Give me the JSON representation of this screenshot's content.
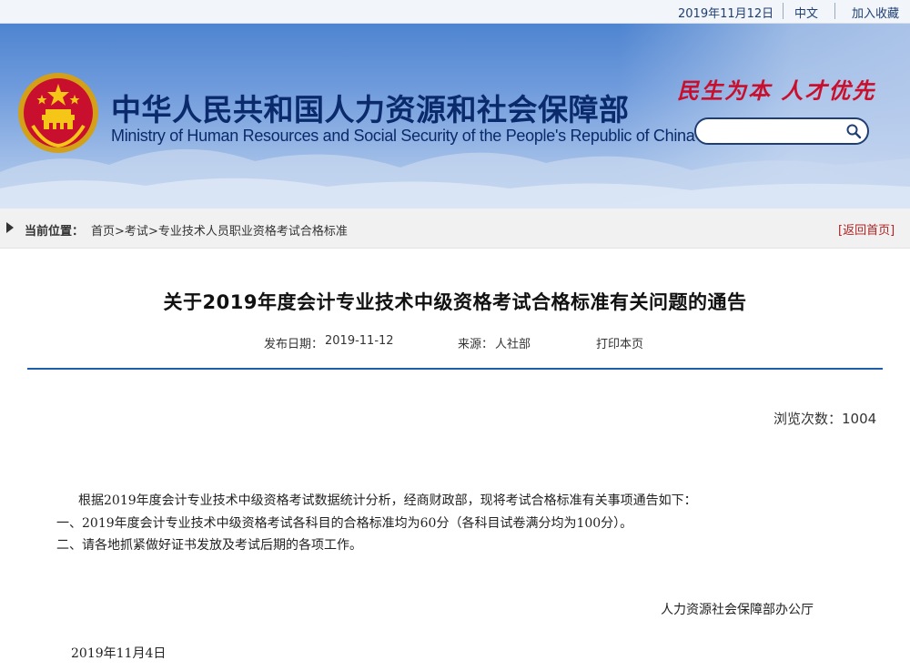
{
  "topbar": {
    "date": "2019年11月12日",
    "lang": "中文",
    "favorite": "加入收藏"
  },
  "header": {
    "org_name_cn": "中华人民共和国人力资源和社会保障部",
    "org_name_en": "Ministry of Human Resources and Social Security of the People's Republic of China",
    "slogan": "民生为本  人才优先",
    "search": {
      "placeholder": "",
      "value": ""
    },
    "emblem_icon": "national-emblem-icon",
    "colors": {
      "brand_blue": "#0a2a6b",
      "slogan_red": "#c8102e"
    }
  },
  "breadcrumb": {
    "label": "当前位置：",
    "items": [
      "首页",
      "考试",
      "专业技术人员职业资格考试合格标准"
    ],
    "separator": ">",
    "back_home": "[返回首页]"
  },
  "article": {
    "title": "关于2019年度会计专业技术中级资格考试合格标准有关问题的通告",
    "publish_label": "发布日期：",
    "publish_date": "2019-11-12",
    "source_label": "来源：",
    "source": "人社部",
    "print_label": "打印本页",
    "views_label": "浏览次数：",
    "views": "1004",
    "paragraphs": [
      "根据2019年度会计专业技术中级资格考试数据统计分析，经商财政部，现将考试合格标准有关事项通告如下：",
      "一、2019年度会计专业技术中级资格考试各科目的合格标准均为60分（各科目试卷满分均为100分）。",
      "二、请各地抓紧做好证书发放及考试后期的各项工作。"
    ],
    "signature": "人力资源社会保障部办公厅",
    "sign_date": "2019年11月4日"
  }
}
